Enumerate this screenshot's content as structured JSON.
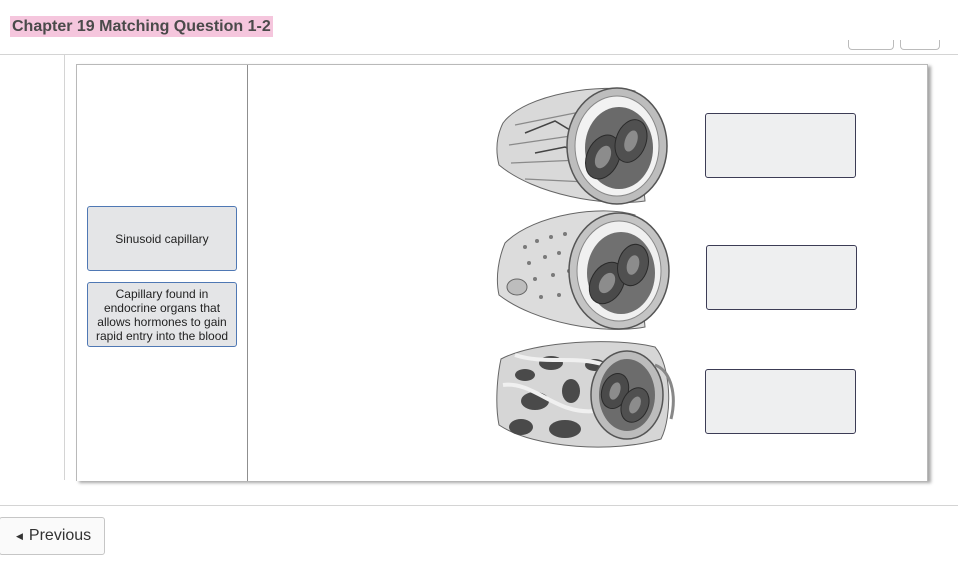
{
  "header": {
    "title": "Chapter 19 Matching Question 1-2"
  },
  "matching": {
    "drag_items": [
      {
        "label": "Sinusoid capillary"
      },
      {
        "label": "Capillary found in endocrine organs that allows hormones to gain rapid entry into the blood"
      }
    ],
    "illustrations": [
      {
        "icon": "continuous-capillary-illustration"
      },
      {
        "icon": "fenestrated-capillary-illustration"
      },
      {
        "icon": "sinusoid-capillary-illustration"
      }
    ],
    "drop_targets": [
      {
        "value": ""
      },
      {
        "value": ""
      },
      {
        "value": ""
      }
    ]
  },
  "footer": {
    "previous_label": "Previous",
    "previous_icon": "caret-left-icon"
  },
  "colors": {
    "title_highlight": "#f5c6dd",
    "tile_border": "#4f78b4",
    "tile_fill": "#e4e5e7",
    "drop_border": "#3c3c55"
  }
}
